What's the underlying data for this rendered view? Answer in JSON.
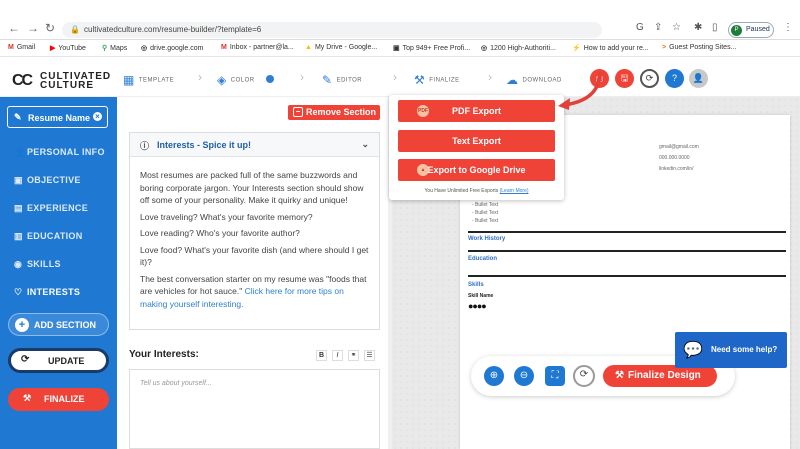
{
  "browser": {
    "url": "cultivatedculture.com/resume-builder/?template=6",
    "profile_initial": "P",
    "profile_status": "Paused"
  },
  "bookmarks": [
    {
      "label": "Gmail",
      "icon": "M"
    },
    {
      "label": "YouTube",
      "icon": "▶"
    },
    {
      "label": "Maps",
      "icon": "⚲"
    },
    {
      "label": "drive.google.com",
      "icon": "◎"
    },
    {
      "label": "Inbox - partner@la...",
      "icon": "M"
    },
    {
      "label": "My Drive - Google...",
      "icon": "▲"
    },
    {
      "label": "Top 949+ Free Profi...",
      "icon": "▣"
    },
    {
      "label": "1200 High-Authoriti...",
      "icon": "◎"
    },
    {
      "label": "How to add your re...",
      "icon": "⚡"
    },
    {
      "label": "Guest Posting Sites...",
      "icon": ">"
    }
  ],
  "brand": {
    "line1": "CULTIVATED",
    "line2": "CULTURE"
  },
  "steps": [
    {
      "label": "TEMPLATE",
      "icon": "▦"
    },
    {
      "label": "COLOR",
      "icon": "◈"
    },
    {
      "label": "EDITOR",
      "icon": "✎"
    },
    {
      "label": "FINALIZE",
      "icon": "⚒"
    },
    {
      "label": "DOWNLOAD",
      "icon": "☁"
    }
  ],
  "header_actions": [
    {
      "icon": "⎙",
      "color": "#ef4338"
    },
    {
      "icon": "🖫",
      "color": "#ef4338"
    },
    {
      "icon": "⟳",
      "color": "#ffffff"
    },
    {
      "icon": "?",
      "color": "#1f78d1"
    },
    {
      "icon": "👤",
      "color": "#c8c8c8"
    }
  ],
  "sidebar": {
    "resume_name": "Resume Name",
    "items": [
      {
        "label": "PERSONAL INFO",
        "icon": "👤"
      },
      {
        "label": "OBJECTIVE",
        "icon": "▣"
      },
      {
        "label": "EXPERIENCE",
        "icon": "▤"
      },
      {
        "label": "EDUCATION",
        "icon": "▥"
      },
      {
        "label": "SKILLS",
        "icon": "◉"
      },
      {
        "label": "INTERESTS",
        "icon": "♡"
      }
    ],
    "add_section": "ADD SECTION",
    "update": "UPDATE",
    "finalize": "FINALIZE"
  },
  "editor": {
    "remove_section": "Remove Section",
    "card_title": "Interests - Spice it up!",
    "paragraphs": [
      "Most resumes are packed full of the same buzzwords and boring corporate jargon. Your Interests section should show off some of your personality. Make it quirky and unique!",
      "Love traveling? What's your favorite memory?",
      "Love reading? Who's your favorite author?",
      "Love food? What's your favorite dish (and where should I get it)?"
    ],
    "last_paragraph": "The best conversation starter on my resume was \"foods that are vehicles for hot sauce.\"",
    "link_text": "Click here for more tips on making yourself interesting.",
    "interests_label": "Your Interests:",
    "format_buttons": [
      "B",
      "I",
      "⚭",
      "☰"
    ],
    "placeholder": "Tell us about yourself..."
  },
  "export": {
    "pdf": "PDF Export",
    "text": "Text Export",
    "drive": "Export to Google Drive",
    "note": "You Have Unlimited Free Exports",
    "learn_more": "(Learn More)"
  },
  "preview": {
    "email": "gmail@gmail.com",
    "phone": "000.000.0000",
    "linkedin": "linkedin.com/in/",
    "bullets": [
      "- Bullet Text",
      "- Bullet Text",
      "- Bullet Text"
    ],
    "work_history": "Work History",
    "education": "Education",
    "skills": "Skills",
    "skill_name": "Skill Name",
    "skill_rating": "●●●●",
    "finalize_design": "Finalize Design",
    "help": "Need some help?"
  }
}
